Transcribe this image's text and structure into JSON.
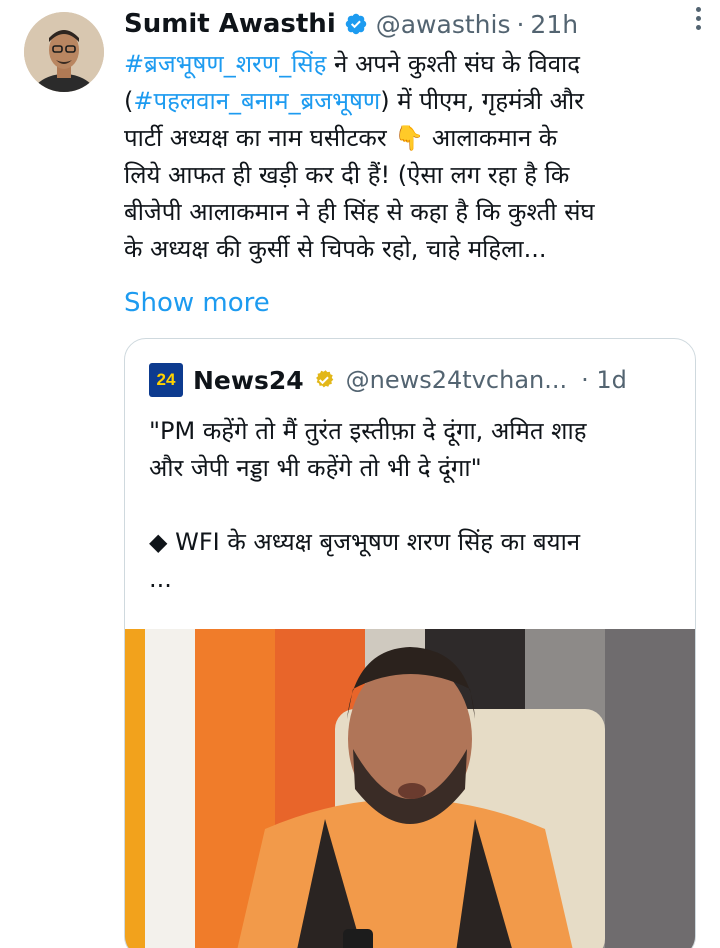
{
  "author": {
    "name": "Sumit Awasthi",
    "handle": "@awasthis",
    "time": "21h"
  },
  "tweet": {
    "lines": [
      {
        "hashtag": "#ब्रजभूषण_शरण_सिंह",
        "text": " ने अपने कुश्ती संघ के विवाद"
      },
      {
        "prefix": "(",
        "hashtag": "#पहलवान_बनाम_ब्रजभूषण",
        "text": ")  में पीएम, गृहमंत्री और"
      },
      {
        "text": "पार्टी अध्यक्ष का नाम घसीटकर ",
        "emoji": "👇",
        "text2": " आलाकमान के"
      },
      {
        "text": "लिये आफत ही खड़ी कर दी हैं! (ऐसा लग रहा है कि"
      },
      {
        "text": "बीजेपी आलाकमान ने ही सिंह से कहा है कि कुश्ती संघ"
      },
      {
        "text": "के अध्यक्ष की कुर्सी से चिपके रहो, चाहे महिला..."
      }
    ],
    "show_more": "Show more"
  },
  "quote": {
    "logo_text": "24",
    "name": "News24",
    "handle": "@news24tvchan...",
    "time": "· 1d",
    "lines": [
      "\"PM कहेंगे तो मैं तुरंत इस्तीफ़ा दे दूंगा, अमित शाह",
      "और जेपी नड्डा भी कहेंगे तो भी दे दूंगा\""
    ],
    "bullet_line": "◆ WFI के अध्यक्ष बृजभूषण शरण सिंह का बयान",
    "ellipsis": "..."
  },
  "icons": {
    "verified": "verified-badge-icon",
    "quote_verified": "gold-verified-badge-icon",
    "more": "more-options-icon"
  },
  "colors": {
    "link": "#1d9bf0",
    "secondary_text": "#536471",
    "verified_blue": "#1d9bf0",
    "verified_gold": "#e2b719"
  }
}
